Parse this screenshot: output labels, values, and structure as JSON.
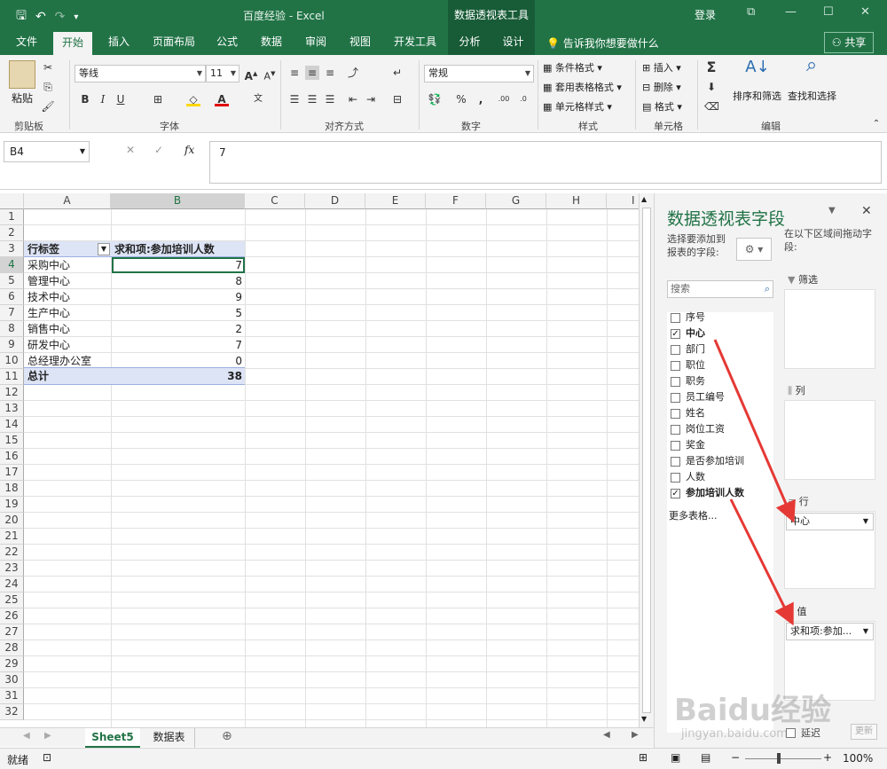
{
  "titlebar": {
    "doc_title": "百度经验 - Excel",
    "context_title": "数据透视表工具",
    "login": "登录",
    "qat": {
      "save_icon": "save-icon",
      "undo_icon": "undo-icon",
      "redo_icon": "redo-icon",
      "customize_icon": "customize-qat-icon"
    }
  },
  "tabs": [
    "文件",
    "开始",
    "插入",
    "页面布局",
    "公式",
    "数据",
    "审阅",
    "视图",
    "开发工具",
    "分析",
    "设计"
  ],
  "active_tab": "开始",
  "tell_me": "告诉我你想要做什么",
  "share": "共享",
  "ribbon": {
    "clipboard": {
      "label": "剪贴板",
      "paste": "粘贴"
    },
    "font": {
      "label": "字体",
      "font_name": "等线",
      "font_size": "11",
      "bold": "B",
      "italic": "I",
      "underline": "U"
    },
    "alignment": {
      "label": "对齐方式"
    },
    "number": {
      "label": "数字",
      "format": "常规"
    },
    "styles": {
      "label": "样式",
      "conditional": "条件格式",
      "table": "套用表格格式",
      "cell": "单元格样式"
    },
    "cells": {
      "label": "单元格",
      "insert": "插入",
      "delete": "删除",
      "format": "格式"
    },
    "editing": {
      "label": "编辑",
      "sort": "排序和筛选",
      "find": "查找和选择"
    }
  },
  "formula_bar": {
    "name_box": "B4",
    "value": "7"
  },
  "columns": [
    "A",
    "B",
    "C",
    "D",
    "E",
    "F",
    "G",
    "H",
    "I"
  ],
  "rows": [
    "1",
    "2",
    "3",
    "4",
    "5",
    "6",
    "7",
    "8",
    "9",
    "10",
    "11",
    "12",
    "13",
    "14",
    "15",
    "16",
    "17",
    "18",
    "19",
    "20",
    "21",
    "22",
    "23",
    "24",
    "25",
    "26",
    "27",
    "28",
    "29",
    "30",
    "31",
    "32"
  ],
  "pivot_table": {
    "header_label": "行标签",
    "header_value": "求和项:参加培训人数",
    "rows": [
      {
        "label": "采购中心",
        "value": "7"
      },
      {
        "label": "管理中心",
        "value": "8"
      },
      {
        "label": "技术中心",
        "value": "9"
      },
      {
        "label": "生产中心",
        "value": "5"
      },
      {
        "label": "销售中心",
        "value": "2"
      },
      {
        "label": "研发中心",
        "value": "7"
      },
      {
        "label": "总经理办公室",
        "value": "0"
      }
    ],
    "total_label": "总计",
    "total_value": "38"
  },
  "sheets": [
    "Sheet5",
    "数据表"
  ],
  "active_sheet": "Sheet5",
  "status": {
    "ready": "就绪",
    "zoom": "100%"
  },
  "pivot_panel": {
    "title": "数据透视表字段",
    "choose_text": "选择要添加到报表的字段:",
    "drag_text": "在以下区域间拖动字段:",
    "search_placeholder": "搜索",
    "fields": [
      {
        "name": "序号",
        "checked": false
      },
      {
        "name": "中心",
        "checked": true
      },
      {
        "name": "部门",
        "checked": false
      },
      {
        "name": "职位",
        "checked": false
      },
      {
        "name": "职务",
        "checked": false
      },
      {
        "name": "员工编号",
        "checked": false
      },
      {
        "name": "姓名",
        "checked": false
      },
      {
        "name": "岗位工资",
        "checked": false
      },
      {
        "name": "奖金",
        "checked": false
      },
      {
        "name": "是否参加培训",
        "checked": false
      },
      {
        "name": "人数",
        "checked": false
      },
      {
        "name": "参加培训人数",
        "checked": true
      }
    ],
    "more_tables": "更多表格...",
    "areas": {
      "filter": "筛选",
      "columns": "列",
      "rows": "行",
      "values": "值"
    },
    "row_item": "中心",
    "value_item": "求和项:参加...",
    "defer": "延迟",
    "update": "更新"
  },
  "watermark": {
    "logo": "Baidu经验",
    "url": "jingyan.baidu.com"
  },
  "colors": {
    "excel_green": "#217346",
    "arrow_red": "#e53935",
    "pivot_header": "#dde4f5"
  }
}
